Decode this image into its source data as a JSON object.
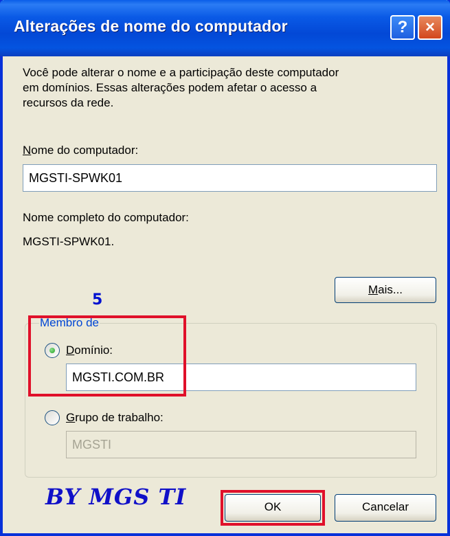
{
  "dialog": {
    "title": "Alterações de nome do computador",
    "help_label": "?",
    "close_label": "×"
  },
  "description": {
    "line1": "Você pode alterar o nome e a participação deste computador",
    "line2": "em domínios. Essas alterações podem afetar o acesso a",
    "line3": "recursos da rede."
  },
  "computer_name": {
    "label_accel": "N",
    "label_rest": "ome do computador:",
    "value": "MGSTI-SPWK01"
  },
  "full_name": {
    "label": "Nome completo do computador:",
    "value": "MGSTI-SPWK01."
  },
  "more_button": {
    "accel": "M",
    "rest": "ais..."
  },
  "annotation": {
    "step": "5",
    "highlight_color": "#e0102a"
  },
  "member_of": {
    "label": "Membro de",
    "domain": {
      "accel": "D",
      "rest": "omínio:",
      "value": "MGSTI.COM.BR",
      "selected": true
    },
    "workgroup": {
      "accel": "G",
      "rest": "rupo de trabalho:",
      "value": "MGSTI",
      "selected": false
    }
  },
  "watermark": "BY MGS TI",
  "buttons": {
    "ok": "OK",
    "cancel": "Cancelar"
  }
}
